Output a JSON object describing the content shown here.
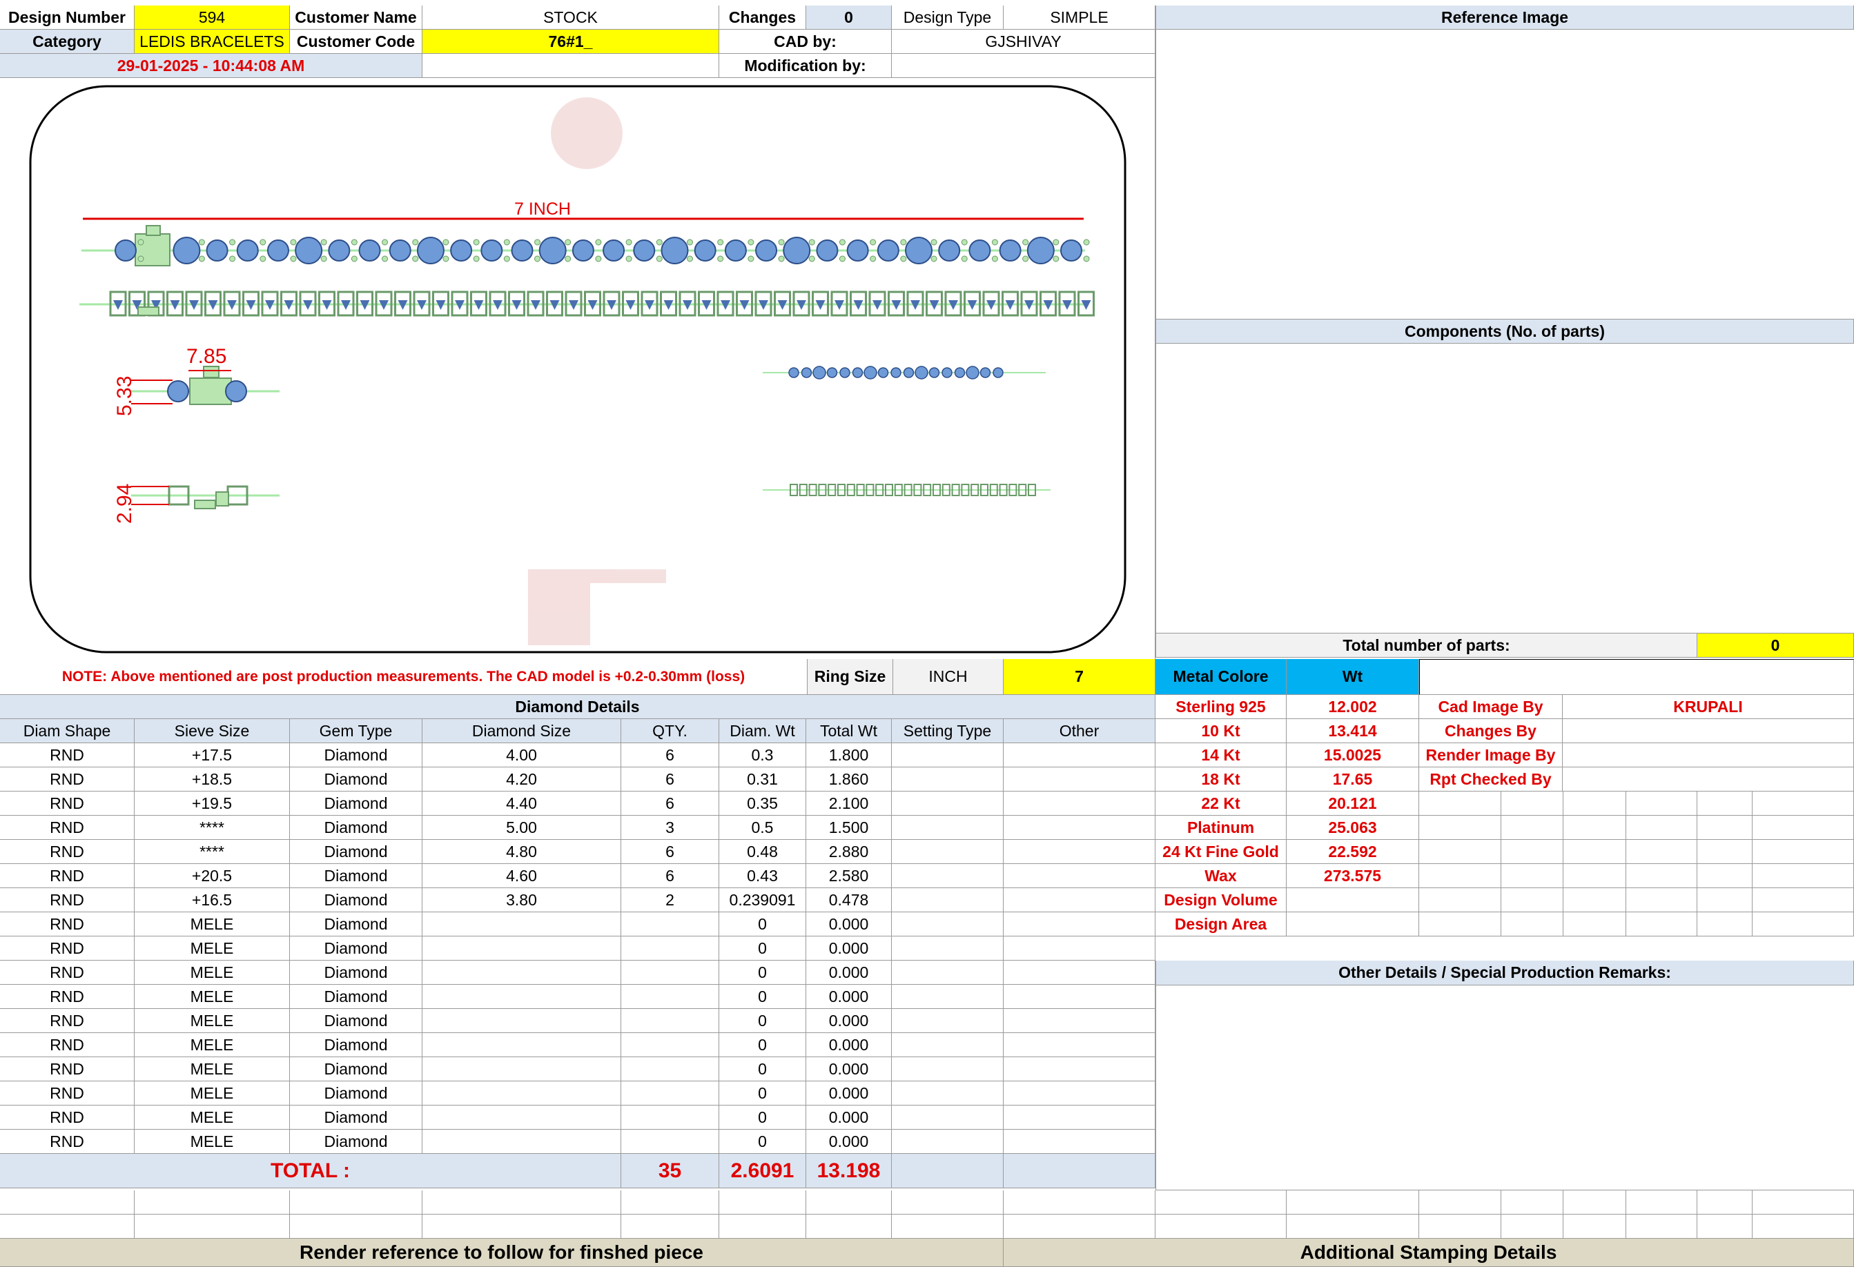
{
  "header": {
    "design_number_label": "Design Number",
    "design_number": "594",
    "customer_name_label": "Customer Name",
    "customer_name": "STOCK",
    "changes_label": "Changes",
    "changes": "0",
    "design_type_label": "Design Type",
    "design_type": "SIMPLE",
    "category_label": "Category",
    "category": "LEDIS BRACELETS",
    "customer_code_label": "Customer Code",
    "customer_code": "76#1_",
    "cad_by_label": "CAD by:",
    "cad_by": "GJSHIVAY",
    "timestamp": "29-01-2025 - 10:44:08 AM",
    "modification_label": "Modification by:",
    "modification": ""
  },
  "right_panel": {
    "reference_image": "Reference Image",
    "components": "Components (No. of parts)",
    "total_parts_label": "Total number of parts:",
    "total_parts": "0"
  },
  "drawing": {
    "length_label": "7 INCH",
    "width_dim": "7.85",
    "height_dim": "5.33",
    "depth_dim": "2.94"
  },
  "note_row": {
    "note": "NOTE: Above mentioned are post production measurements. The CAD model is +0.2-0.30mm (loss)",
    "ring_size_label": "Ring Size",
    "unit": "INCH",
    "ring_size": "7",
    "metal_colore_label": "Metal Colore",
    "wt_label": "Wt"
  },
  "diamond_details": {
    "title": "Diamond Details",
    "columns": [
      "Diam Shape",
      "Sieve Size",
      "Gem Type",
      "Diamond Size",
      "QTY.",
      "Diam. Wt",
      "Total Wt",
      "Setting Type",
      "Other"
    ],
    "rows": [
      [
        "RND",
        "+17.5",
        "Diamond",
        "4.00",
        "6",
        "0.3",
        "1.800",
        "",
        ""
      ],
      [
        "RND",
        "+18.5",
        "Diamond",
        "4.20",
        "6",
        "0.31",
        "1.860",
        "",
        ""
      ],
      [
        "RND",
        "+19.5",
        "Diamond",
        "4.40",
        "6",
        "0.35",
        "2.100",
        "",
        ""
      ],
      [
        "RND",
        "****",
        "Diamond",
        "5.00",
        "3",
        "0.5",
        "1.500",
        "",
        ""
      ],
      [
        "RND",
        "****",
        "Diamond",
        "4.80",
        "6",
        "0.48",
        "2.880",
        "",
        ""
      ],
      [
        "RND",
        "+20.5",
        "Diamond",
        "4.60",
        "6",
        "0.43",
        "2.580",
        "",
        ""
      ],
      [
        "RND",
        "+16.5",
        "Diamond",
        "3.80",
        "2",
        "0.239091",
        "0.478",
        "",
        ""
      ],
      [
        "RND",
        "MELE",
        "Diamond",
        "",
        "",
        "0",
        "0.000",
        "",
        ""
      ],
      [
        "RND",
        "MELE",
        "Diamond",
        "",
        "",
        "0",
        "0.000",
        "",
        ""
      ],
      [
        "RND",
        "MELE",
        "Diamond",
        "",
        "",
        "0",
        "0.000",
        "",
        ""
      ],
      [
        "RND",
        "MELE",
        "Diamond",
        "",
        "",
        "0",
        "0.000",
        "",
        ""
      ],
      [
        "RND",
        "MELE",
        "Diamond",
        "",
        "",
        "0",
        "0.000",
        "",
        ""
      ],
      [
        "RND",
        "MELE",
        "Diamond",
        "",
        "",
        "0",
        "0.000",
        "",
        ""
      ],
      [
        "RND",
        "MELE",
        "Diamond",
        "",
        "",
        "0",
        "0.000",
        "",
        ""
      ],
      [
        "RND",
        "MELE",
        "Diamond",
        "",
        "",
        "0",
        "0.000",
        "",
        ""
      ],
      [
        "RND",
        "MELE",
        "Diamond",
        "",
        "",
        "0",
        "0.000",
        "",
        ""
      ],
      [
        "RND",
        "MELE",
        "Diamond",
        "",
        "",
        "0",
        "0.000",
        "",
        ""
      ]
    ],
    "total_label": "TOTAL :",
    "total_qty": "35",
    "total_diam_wt": "2.6091",
    "total_wt": "13.198"
  },
  "metals": [
    {
      "name": "Sterling 925",
      "wt": "12.002"
    },
    {
      "name": "10 Kt",
      "wt": "13.414"
    },
    {
      "name": "14 Kt",
      "wt": "15.0025"
    },
    {
      "name": "18 Kt",
      "wt": "17.65"
    },
    {
      "name": "22 Kt",
      "wt": "20.121"
    },
    {
      "name": "Platinum",
      "wt": "25.063"
    },
    {
      "name": "24 Kt Fine Gold",
      "wt": "22.592"
    },
    {
      "name": "Wax",
      "wt": "273.575"
    },
    {
      "name": "Design Volume",
      "wt": ""
    },
    {
      "name": "Design Area",
      "wt": ""
    }
  ],
  "credits": [
    {
      "label": "Cad Image By",
      "value": "KRUPALI"
    },
    {
      "label": "Changes By",
      "value": ""
    },
    {
      "label": "Render Image By",
      "value": ""
    },
    {
      "label": "Rpt Checked By",
      "value": ""
    }
  ],
  "other_details": "Other Details / Special Production Remarks:",
  "footer": {
    "render_reference": "Render reference to follow for finshed piece",
    "stamping": "Additional Stamping Details"
  }
}
